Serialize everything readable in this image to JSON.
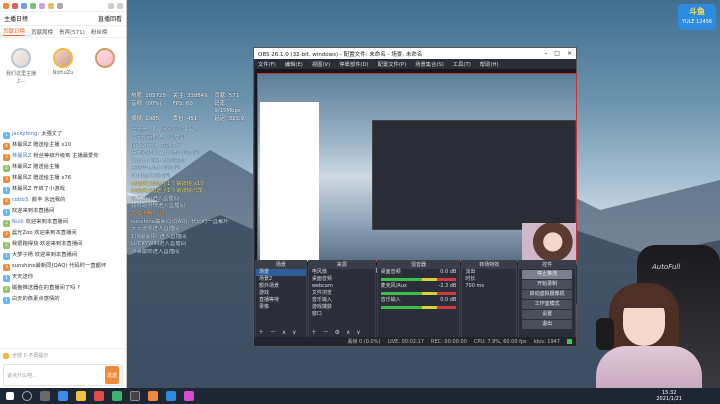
{
  "assistant": {
    "tabs": [
      "贡献日榜",
      "贡献周榜",
      "贵宾(571)",
      "粉丝榜"
    ],
    "header_left": "主播日榜",
    "header_right": "直播回看",
    "ranks": [
      {
        "name": "我们这里主播上...",
        "cls": "two"
      },
      {
        "name": "NizhuZu",
        "cls": "one"
      },
      {
        "name": "",
        "cls": "three"
      }
    ],
    "messages": [
      {
        "badge": "1",
        "color": "#66b6f3",
        "who": "jackyfeng:",
        "txt": "太强丈了"
      },
      {
        "badge": "4",
        "color": "#f08a3a",
        "who": "",
        "txt": "林最风Z 赠送给主播 x10"
      },
      {
        "badge": "3",
        "color": "#f08a3a",
        "who": "林最风Z",
        "txt": "粉丝等级升级到 主播最爱你"
      },
      {
        "badge": "2",
        "color": "#8fc46a",
        "who": "",
        "txt": "林最风Z 赠送给主播"
      },
      {
        "badge": "3",
        "color": "#f08a3a",
        "who": "",
        "txt": "林最风Z 赠送给主播 x76"
      },
      {
        "badge": "1",
        "color": "#66b6f3",
        "who": "",
        "txt": "林最风Z 开启了小游戏"
      },
      {
        "badge": "4",
        "color": "#f08a3a",
        "who": "cobb3:",
        "txt": "颜丰 永远我的"
      },
      {
        "badge": "1",
        "color": "#66b6f3",
        "who": "",
        "txt": "欢迎来到本直播间"
      },
      {
        "badge": "2",
        "color": "#8fc46a",
        "who": "Nulli",
        "txt": "欢迎来到本直播间"
      },
      {
        "badge": "3",
        "color": "#f08a3a",
        "who": "",
        "txt": "晨光Zoo 欢迎来到本直播间"
      },
      {
        "badge": "2",
        "color": "#8fc46a",
        "who": "",
        "txt": "我很跑得快 欢迎来到本直播间"
      },
      {
        "badge": "1",
        "color": "#66b6f3",
        "who": "",
        "txt": "大梦子杨 欢迎来到本直播间"
      },
      {
        "badge": "3",
        "color": "#f08a3a",
        "who": "",
        "txt": "sunshine最新同(QAQ) 代码时一直都坏"
      },
      {
        "badge": "1",
        "color": "#66b6f3",
        "who": "",
        "txt": "天天送你"
      },
      {
        "badge": "2",
        "color": "#8fc46a",
        "who": "",
        "txt": "磁盘推送器在的直播间了吗 ?"
      },
      {
        "badge": "1",
        "color": "#66b6f3",
        "who": "",
        "txt": "白天的像素点感情的"
      }
    ],
    "input_hint": "全部 0 不再提示",
    "send_placeholder": "说点什么吧...",
    "send_label": "发送"
  },
  "overlay": {
    "stats": [
      "热度: 185725",
      "关注: 338849",
      "贡献: 571",
      "音频: (00%)",
      "FPS: 60",
      "码率: 9/15Mbps",
      "掉帧: 1985",
      "丢包: 451",
      "延迟: 323.9"
    ],
    "lines": [
      {
        "t": "马嗒嗒 - 顾影频道了个1会员",
        "c": ""
      },
      {
        "t": "今天给新的进入直播间",
        "c": ""
      },
      {
        "t": "jackyfeng: 太强丈了",
        "c": ""
      },
      {
        "t": "晨光猪猪XiaZhu进入直播间",
        "c": ""
      },
      {
        "t": "cobb3: 颜丰 永远我的",
        "c": ""
      },
      {
        "t": "紫色卑林进入直播间",
        "c": ""
      },
      {
        "t": "NuIli进入直播间",
        "c": ""
      },
      {
        "t": "林最风Z赠送了1个钢铁侠 x10",
        "c": "yellow"
      },
      {
        "t": "林最风Z赠送了1个钢铁侠汽车",
        "c": "yellow"
      },
      {
        "t": "晨光Zoo进入直播间",
        "c": ""
      },
      {
        "t": "我很跑得快进入直播间",
        "c": ""
      },
      {
        "t": "大梦子杨: 玛?",
        "c": "orange"
      },
      {
        "t": "sunshine最新同(QAQ): 代码时一直都坏",
        "c": ""
      },
      {
        "t": "天天送你进入直播间",
        "c": ""
      },
      {
        "t": "1顶部家中: 进入直播间",
        "c": ""
      },
      {
        "t": "LUCKYWIN进入直播间",
        "c": ""
      },
      {
        "t": "沙漠最帅进入直播间",
        "c": ""
      }
    ]
  },
  "obs": {
    "title": "OBS 26.1.0 (32-bit, windows) - 配置文件: 未命名 - 场景: 未命名",
    "menus": [
      "文件(F)",
      "编辑(E)",
      "视图(V)",
      "停靠部件(D)",
      "配置文件(P)",
      "场景集合(S)",
      "工具(T)",
      "帮助(H)"
    ],
    "scenes_title": "场景",
    "scenes": [
      "场景",
      "场景2",
      "额外场景",
      "游戏",
      "直播等待",
      "录像"
    ],
    "sources_title": "来源",
    "sources": [
      "电风扇",
      "桌面音频",
      "webcam",
      "文件浏览",
      "音乐输入",
      "游戏捕获",
      "窗口"
    ],
    "mixer_title": "混音器",
    "mixer": [
      "桌面音频",
      "麦克风/Aux",
      "音乐输入"
    ],
    "mixer_db": [
      "0.0 dB",
      "-2.3 dB",
      "0.0 dB"
    ],
    "transition_title": "转场特效",
    "transition": [
      "淡出",
      "时长",
      "700 ms"
    ],
    "controls_title": "控件",
    "controls": [
      "停止推流",
      "开始录制",
      "启动虚拟摄像机",
      "工作室模式",
      "设置",
      "退出"
    ],
    "status": [
      "丢帧 0 (0.0%)",
      "LIVE: 00:02:17",
      "REC: 00:00:00",
      "CPU: 7.9%, 60.00 fps",
      "kb/s: 1947"
    ],
    "preview_label": "场景",
    "preview_items": [
      "图像",
      "无源",
      "属性",
      "滤镜",
      "桌面",
      "采集音频设备",
      "(默认)"
    ]
  },
  "logo": {
    "big": "斗鱼",
    "small": "YULE 12456"
  },
  "desktop": {
    "chair_brand": "AutoFull"
  },
  "taskbar": {
    "time": "15:32",
    "date": "2021/1/21"
  },
  "colors": {
    "accent": "#e8652c",
    "obs_bg": "#2b2e38",
    "live": "#2fd14b"
  }
}
